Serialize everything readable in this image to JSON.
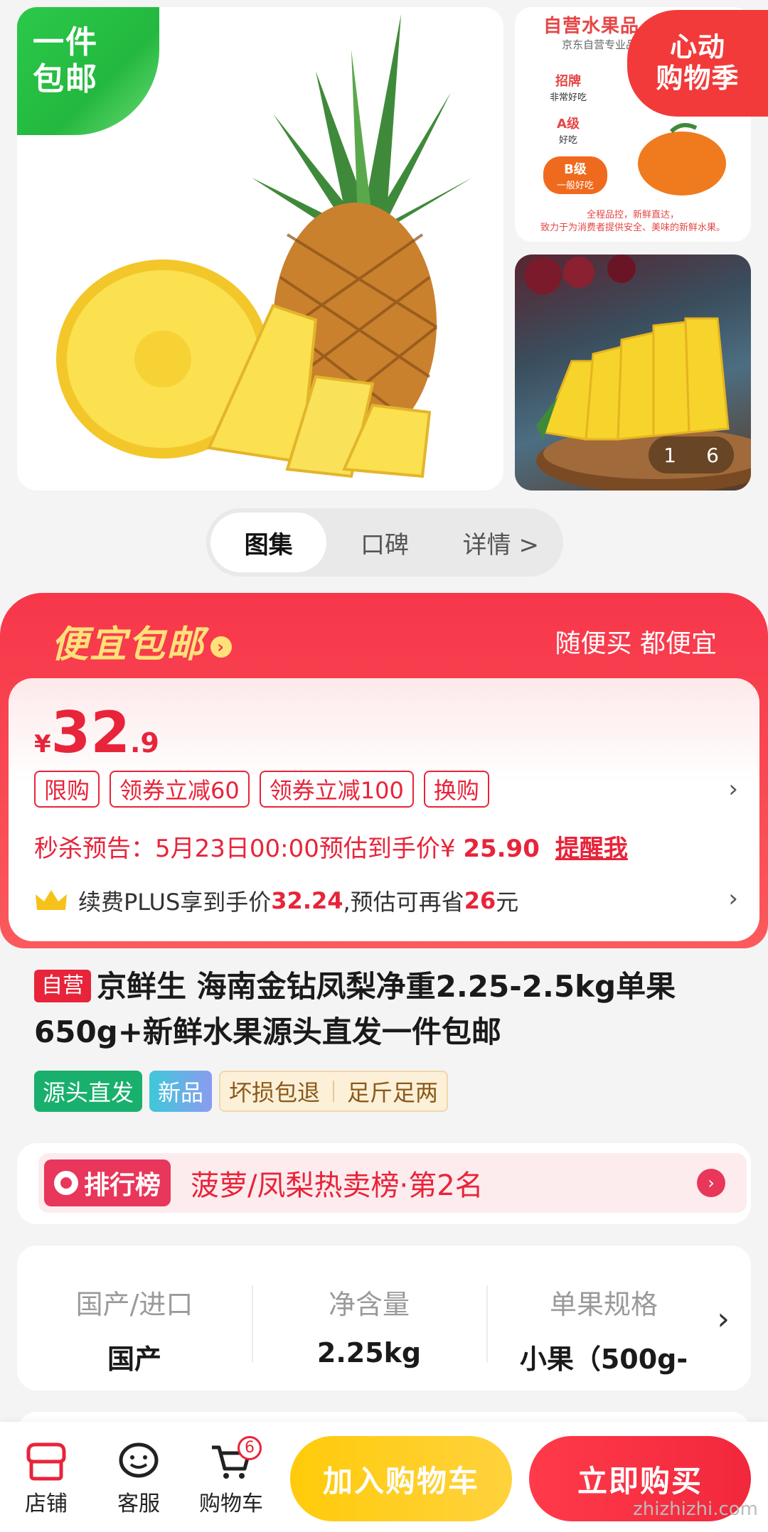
{
  "gallery": {
    "corner_badge": "一件\n包邮",
    "quality_panel": {
      "title": "自营水果品",
      "subtitle": "京东自营专业品",
      "grades": [
        {
          "name": "招牌",
          "desc": "非常好吃"
        },
        {
          "name": "A级",
          "desc": "好吃"
        },
        {
          "name": "B级",
          "desc": "一般好吃"
        }
      ],
      "footer": "全程品控，新鲜直达，\n致力于为消费者提供安全、美味的新鲜水果。"
    },
    "promo_badge": "心动\n购物季",
    "counter_current": "1",
    "counter_total": "6"
  },
  "tabs": [
    {
      "label": "图集",
      "active": true
    },
    {
      "label": "口碑",
      "active": false
    },
    {
      "label": "详情 >",
      "active": false
    }
  ],
  "promo": {
    "banner_left": "便宜包邮",
    "banner_right": "随便买 都便宜",
    "price_currency": "¥",
    "price_int": "32",
    "price_dec": ".9",
    "chips": [
      "限购",
      "领券立减60",
      "领券立减100",
      "换购"
    ],
    "flash_prefix": "秒杀预告：5月23日00:00预估到手价¥ ",
    "flash_price": "25.90",
    "flash_remind": "提醒我",
    "plus_a": "续费PLUS享到手价",
    "plus_price": "32.24",
    "plus_b": ",预估可再省",
    "plus_save": "26",
    "plus_c": "元"
  },
  "product": {
    "self_tag": "自营",
    "title": "京鲜生 海南金钻凤梨净重2.25-2.5kg单果650g+新鲜水果源头直发一件包邮",
    "tags": [
      "源头直发",
      "新品",
      "坏损包退",
      "足斤足两"
    ]
  },
  "rank": {
    "badge": "排行榜",
    "text": "菠萝/凤梨热卖榜·第2名"
  },
  "specs": [
    {
      "label": "国产/进口",
      "value": "国产"
    },
    {
      "label": "净含量",
      "value": "2.25kg"
    },
    {
      "label": "单果规格",
      "value": "小果（500g‑"
    }
  ],
  "bottom": {
    "shop": "店铺",
    "service": "客服",
    "cart": "购物车",
    "cart_count": "6",
    "add_to_cart": "加入购物车",
    "buy_now": "立即购买"
  },
  "watermark": "zhizhizhi.com",
  "colors": {
    "accent_red": "#e8243a",
    "yellow": "#ffcb0a",
    "green": "#2bc94a"
  }
}
